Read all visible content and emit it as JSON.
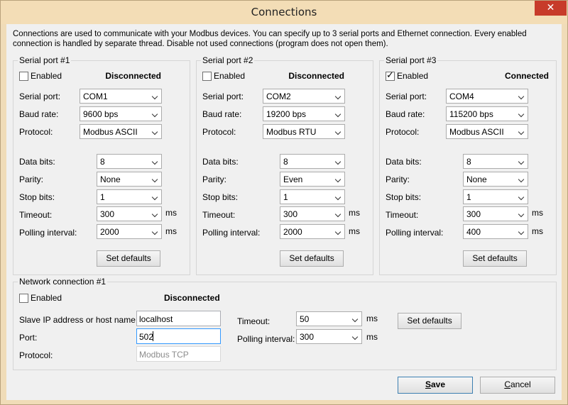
{
  "window": {
    "title": "Connections",
    "close_symbol": "✕"
  },
  "description": "Connections are used to communicate with your Modbus devices. You can specify up to 3 serial ports and Ethernet connection. Every enabled connection is handled by separate thread. Disable not used connections (program does not open them).",
  "labels": {
    "enabled": "Enabled",
    "serial_port": "Serial port:",
    "baud_rate": "Baud rate:",
    "protocol": "Protocol:",
    "data_bits": "Data bits:",
    "parity": "Parity:",
    "stop_bits": "Stop bits:",
    "timeout": "Timeout:",
    "polling_interval": "Polling interval:",
    "ms": "ms",
    "set_defaults": "Set defaults"
  },
  "serial_ports": [
    {
      "title": "Serial port #1",
      "enabled": false,
      "status": "Disconnected",
      "port": "COM1",
      "baud": "9600 bps",
      "protocol": "Modbus ASCII",
      "data_bits": "8",
      "parity": "None",
      "stop_bits": "1",
      "timeout": "300",
      "polling": "2000"
    },
    {
      "title": "Serial port #2",
      "enabled": false,
      "status": "Disconnected",
      "port": "COM2",
      "baud": "19200 bps",
      "protocol": "Modbus RTU",
      "data_bits": "8",
      "parity": "Even",
      "stop_bits": "1",
      "timeout": "300",
      "polling": "2000"
    },
    {
      "title": "Serial port #3",
      "enabled": true,
      "status": "Connected",
      "port": "COM4",
      "baud": "115200 bps",
      "protocol": "Modbus ASCII",
      "data_bits": "8",
      "parity": "None",
      "stop_bits": "1",
      "timeout": "300",
      "polling": "400"
    }
  ],
  "network": {
    "title": "Network connection #1",
    "enabled": false,
    "status": "Disconnected",
    "host_label": "Slave IP address or host name:",
    "host": "localhost",
    "port_label": "Port:",
    "port": "502",
    "protocol_label": "Protocol:",
    "protocol": "Modbus TCP",
    "timeout_label": "Timeout:",
    "timeout": "50",
    "polling_label": "Polling interval:",
    "polling": "300"
  },
  "buttons": {
    "save_rest": "ave",
    "save_key": "S",
    "cancel_rest": "ancel",
    "cancel_key": "C"
  }
}
